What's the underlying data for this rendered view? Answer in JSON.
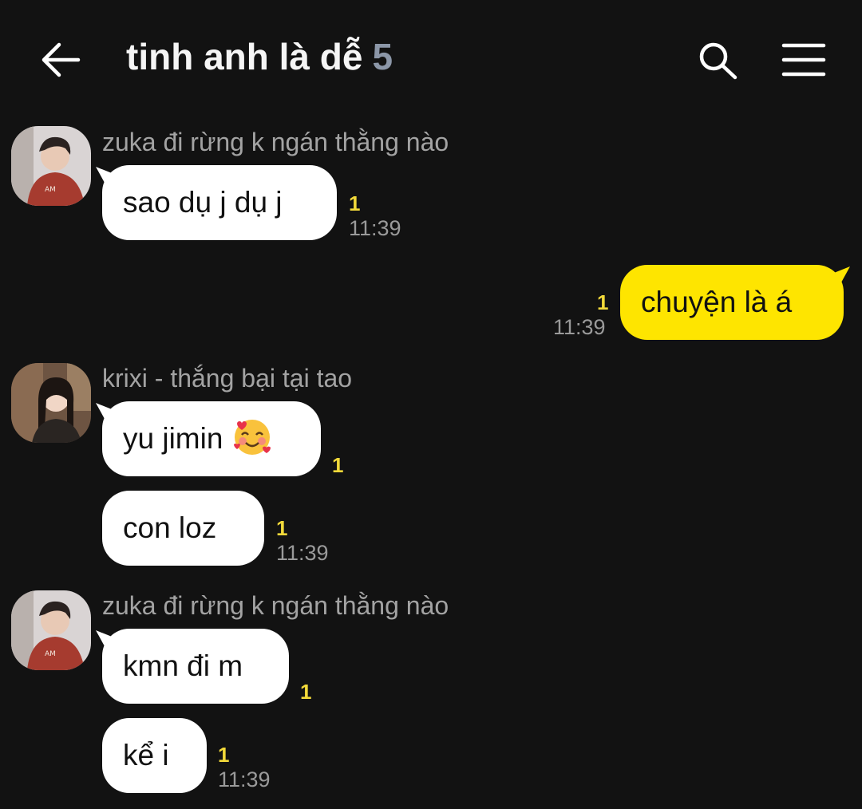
{
  "header": {
    "title": "tinh anh là dễ",
    "member_count": "5",
    "back_icon": "arrow-left-icon",
    "search_icon": "search-icon",
    "menu_icon": "hamburger-menu-icon"
  },
  "colors": {
    "background": "#121212",
    "incoming_bubble": "#ffffff",
    "outgoing_bubble": "#fee500",
    "unread_count": "#f2d93a"
  },
  "messages": [
    {
      "sender": "zuka đi rừng k ngán thằng nào",
      "text": "sao dụ j dụ j",
      "unread": "1",
      "time": "11:39"
    },
    {
      "sender": "",
      "text": "chuyện là á",
      "unread": "1",
      "time": "11:39",
      "outgoing": true
    },
    {
      "sender": "krixi - thắng bại tại tao",
      "text": "yu jimin",
      "emoji": "smiling-face-with-hearts",
      "unread": "1",
      "time": ""
    },
    {
      "sender": "",
      "text": "con loz",
      "unread": "1",
      "time": "11:39"
    },
    {
      "sender": "zuka đi rừng k ngán thằng nào",
      "text": "kmn đi m",
      "unread": "1",
      "time": ""
    },
    {
      "sender": "",
      "text": "kể i",
      "unread": "1",
      "time": "11:39"
    }
  ]
}
